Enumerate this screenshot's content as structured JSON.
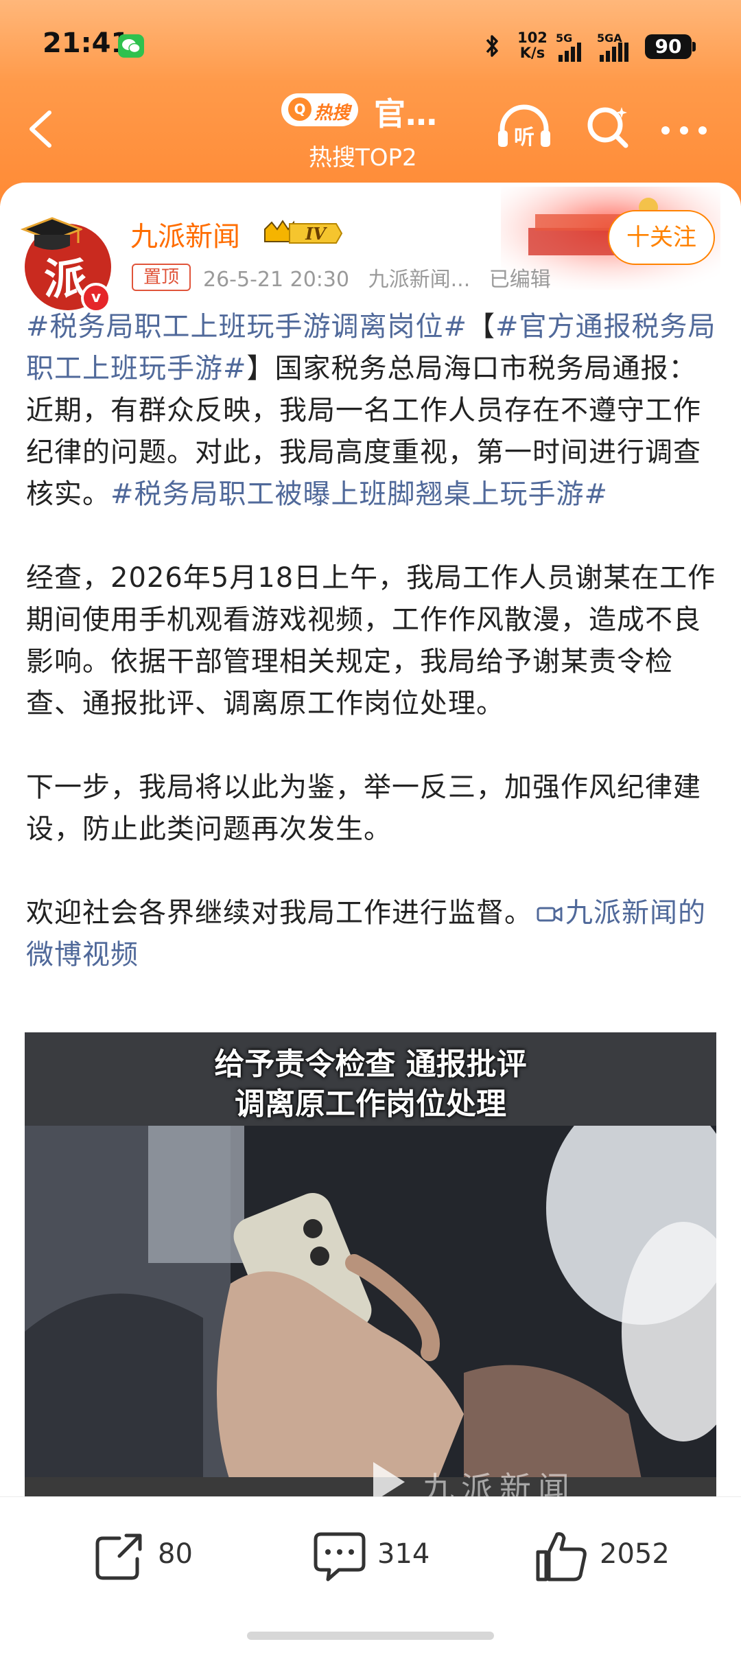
{
  "status_bar": {
    "time": "21:41",
    "net_speed_value": "102",
    "net_speed_unit": "K/s",
    "signal_1": "5G",
    "signal_2": "5GA",
    "battery": "90"
  },
  "header": {
    "hot_badge": "热搜",
    "title": "官…",
    "subtitle": "热搜TOP2",
    "icons": [
      "back-icon",
      "listen-icon",
      "search-icon",
      "more-icon"
    ],
    "listen_label": "听"
  },
  "post": {
    "author": "九派新闻",
    "level_badge": "IV",
    "follow_label": "十关注",
    "pinned_label": "置顶",
    "date": "26-5-21 20:30",
    "source": "九派新闻...",
    "edited": "已编辑",
    "paragraph_1": {
      "topic_1": "#税务局职工上班玩手游调离岗位#",
      "bracket_open": "【",
      "topic_2": "#官方通报税务局职工上班玩手游#",
      "bracket_close": "】",
      "text": "国家税务总局海口市税务局通报：近期，有群众反映，我局一名工作人员存在不遵守工作纪律的问题。对此，我局高度重视，第一时间进行调查核实。",
      "topic_3": "#税务局职工被曝上班脚翘桌上玩手游#"
    },
    "paragraph_2": "经查，2026年5月18日上午，我局工作人员谢某在工作期间使用手机观看游戏视频，工作作风散漫，造成不良影响。依据干部管理相关规定，我局给予谢某责令检查、通报批评、调离原工作岗位处理。",
    "paragraph_3": "下一步，我局将以此为鉴，举一反三，加强作风纪律建设，防止此类问题再次发生。",
    "paragraph_4": "欢迎社会各界继续对我局工作进行监督。",
    "video_link": "九派新闻的微博视频",
    "video": {
      "caption_line_1": "给予责令检查 通报批评",
      "caption_line_2": "调离原工作岗位处理",
      "watermark": "九派新闻"
    }
  },
  "actions": {
    "repost_count": "80",
    "comment_count": "314",
    "like_count": "2052"
  },
  "colors": {
    "header_orange": "#ff8a35",
    "author_orange": "#ff6d00",
    "topic_blue": "#50699a",
    "follow_orange": "#ff8200"
  }
}
